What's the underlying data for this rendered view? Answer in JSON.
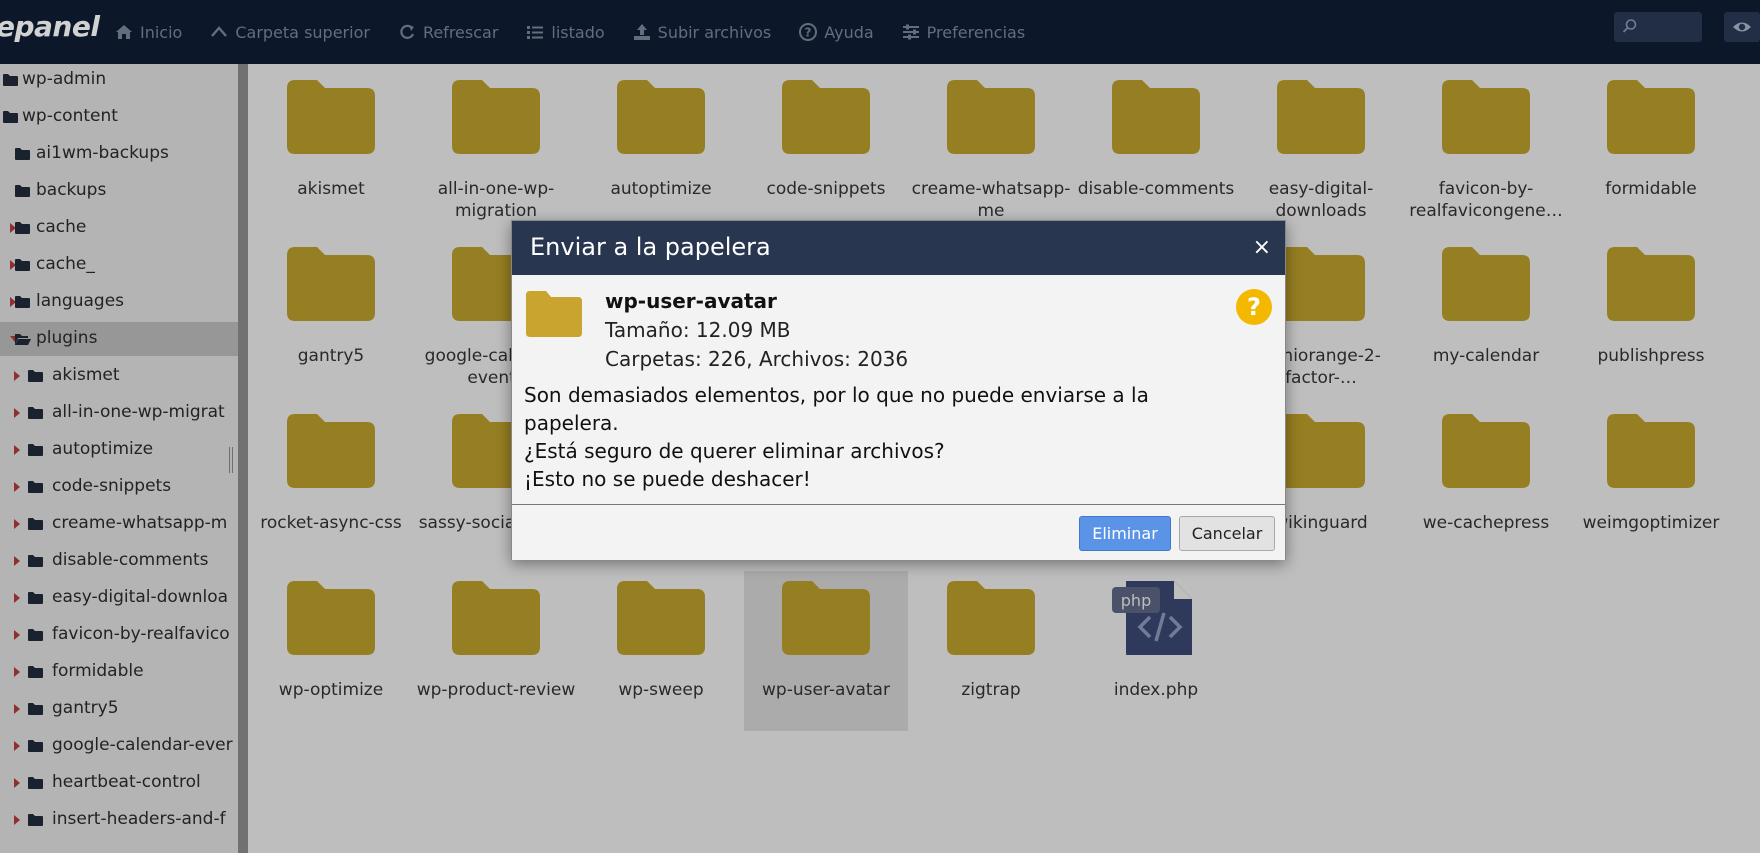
{
  "app": {
    "logo": "epanel"
  },
  "toolbar": [
    {
      "label": "Inicio",
      "icon": "home-icon"
    },
    {
      "label": "Carpeta superior",
      "icon": "chevron-up-icon"
    },
    {
      "label": "Refrescar",
      "icon": "refresh-icon"
    },
    {
      "label": "listado",
      "icon": "list-icon"
    },
    {
      "label": "Subir archivos",
      "icon": "upload-icon"
    },
    {
      "label": "Ayuda",
      "icon": "help-icon"
    },
    {
      "label": "Preferencias",
      "icon": "sliders-icon"
    }
  ],
  "search": {
    "placeholder": ""
  },
  "sidebar": {
    "items": [
      {
        "label": "wp-admin",
        "level": 0,
        "arrow": "none",
        "open": false,
        "selected": false
      },
      {
        "label": "wp-content",
        "level": 0,
        "arrow": "none",
        "open": false,
        "selected": false
      },
      {
        "label": "ai1wm-backups",
        "level": 1,
        "arrow": "none",
        "open": false,
        "selected": false
      },
      {
        "label": "backups",
        "level": 1,
        "arrow": "none",
        "open": false,
        "selected": false
      },
      {
        "label": "cache",
        "level": 1,
        "arrow": "right",
        "open": false,
        "selected": false
      },
      {
        "label": "cache_",
        "level": 1,
        "arrow": "right",
        "open": false,
        "selected": false
      },
      {
        "label": "languages",
        "level": 1,
        "arrow": "right",
        "open": false,
        "selected": false
      },
      {
        "label": "plugins",
        "level": 1,
        "arrow": "down",
        "open": true,
        "selected": true
      },
      {
        "label": "akismet",
        "level": 2,
        "arrow": "right",
        "open": false,
        "selected": false
      },
      {
        "label": "all-in-one-wp-migrat",
        "level": 2,
        "arrow": "right",
        "open": false,
        "selected": false
      },
      {
        "label": "autoptimize",
        "level": 2,
        "arrow": "right",
        "open": false,
        "selected": false
      },
      {
        "label": "code-snippets",
        "level": 2,
        "arrow": "right",
        "open": false,
        "selected": false
      },
      {
        "label": "creame-whatsapp-m",
        "level": 2,
        "arrow": "right",
        "open": false,
        "selected": false
      },
      {
        "label": "disable-comments",
        "level": 2,
        "arrow": "right",
        "open": false,
        "selected": false
      },
      {
        "label": "easy-digital-downloa",
        "level": 2,
        "arrow": "right",
        "open": false,
        "selected": false
      },
      {
        "label": "favicon-by-realfavico",
        "level": 2,
        "arrow": "right",
        "open": false,
        "selected": false
      },
      {
        "label": "formidable",
        "level": 2,
        "arrow": "right",
        "open": false,
        "selected": false
      },
      {
        "label": "gantry5",
        "level": 2,
        "arrow": "right",
        "open": false,
        "selected": false
      },
      {
        "label": "google-calendar-ever",
        "level": 2,
        "arrow": "right",
        "open": false,
        "selected": false
      },
      {
        "label": "heartbeat-control",
        "level": 2,
        "arrow": "right",
        "open": false,
        "selected": false
      },
      {
        "label": "insert-headers-and-f",
        "level": 2,
        "arrow": "right",
        "open": false,
        "selected": false
      }
    ]
  },
  "files": [
    {
      "name": "akismet",
      "type": "folder"
    },
    {
      "name": "all-in-one-wp-migration",
      "type": "folder"
    },
    {
      "name": "autoptimize",
      "type": "folder"
    },
    {
      "name": "code-snippets",
      "type": "folder"
    },
    {
      "name": "creame-whatsapp-me",
      "type": "folder"
    },
    {
      "name": "disable-comments",
      "type": "folder"
    },
    {
      "name": "easy-digital-downloads",
      "type": "folder"
    },
    {
      "name": "favicon-by-realfavicongene…",
      "type": "folder"
    },
    {
      "name": "formidable",
      "type": "folder"
    },
    {
      "name": "gantry5",
      "type": "folder"
    },
    {
      "name": "google-calendar-events",
      "type": "folder"
    },
    {
      "name": "",
      "type": "folder"
    },
    {
      "name": "",
      "type": "folder"
    },
    {
      "name": "",
      "type": "folder"
    },
    {
      "name": "",
      "type": "folder"
    },
    {
      "name": "miniorange-2-factor-…",
      "type": "folder"
    },
    {
      "name": "my-calendar",
      "type": "folder"
    },
    {
      "name": "publishpress",
      "type": "folder"
    },
    {
      "name": "rocket-async-css",
      "type": "folder"
    },
    {
      "name": "sassy-social-share",
      "type": "folder"
    },
    {
      "name": "",
      "type": "folder"
    },
    {
      "name": "",
      "type": "folder"
    },
    {
      "name": "",
      "type": "folder"
    },
    {
      "name": "",
      "type": "folder"
    },
    {
      "name": "wikinguard",
      "type": "folder"
    },
    {
      "name": "we-cachepress",
      "type": "folder"
    },
    {
      "name": "weimgoptimizer",
      "type": "folder"
    },
    {
      "name": "wp-optimize",
      "type": "folder"
    },
    {
      "name": "wp-product-review",
      "type": "folder"
    },
    {
      "name": "wp-sweep",
      "type": "folder"
    },
    {
      "name": "wp-user-avatar",
      "type": "folder",
      "selected": true
    },
    {
      "name": "zigtrap",
      "type": "folder"
    },
    {
      "name": "index.php",
      "type": "php",
      "badge": "php"
    }
  ],
  "dialog": {
    "title": "Enviar a la papelera",
    "close": "×",
    "item_name": "wp-user-avatar",
    "size": "Tamaño: 12.09 MB",
    "counts": "Carpetas: 226, Archivos: 2036",
    "question_mark": "?",
    "message_lines": [
      "Son demasiados elementos, por lo que no puede enviarse a la",
      "papelera.",
      "¿Está seguro de querer eliminar archivos?",
      "¡Esto no se puede deshacer!"
    ],
    "confirm_label": "Eliminar",
    "cancel_label": "Cancelar"
  },
  "colors": {
    "topbar": "#0f1d33",
    "folder": "#b89a2a",
    "dialog_header": "#283650",
    "primary_button": "#5b93e6",
    "question_icon": "#f5b800",
    "php_file": "#3a4670"
  }
}
